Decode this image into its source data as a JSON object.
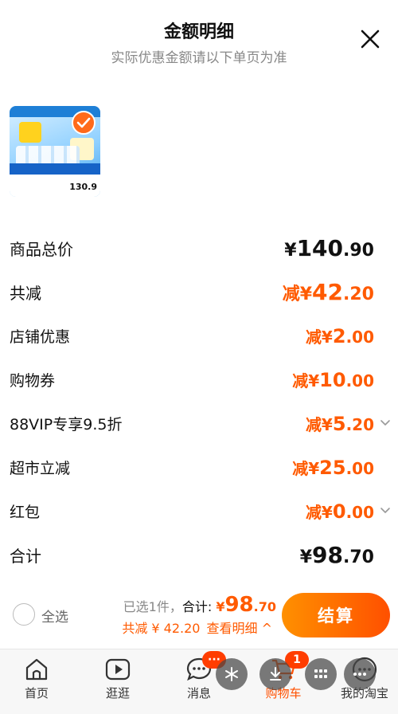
{
  "header": {
    "title": "金额明细",
    "subtitle": "实际优惠金额请以下单页为准"
  },
  "product": {
    "thumbnail_price": "130.9",
    "selected": true
  },
  "rows": {
    "total_price": {
      "label": "商品总价",
      "currency": "¥",
      "int": "140",
      "dec": ".90"
    },
    "total_discount": {
      "label": "共减",
      "prefix": "减¥",
      "int": "42",
      "dec": ".20"
    },
    "shop_discount": {
      "label": "店铺优惠",
      "prefix": "减¥",
      "int": "2",
      "dec": ".00"
    },
    "coupon": {
      "label": "购物券",
      "prefix": "减¥",
      "int": "10",
      "dec": ".00"
    },
    "vip": {
      "label": "88VIP专享9.5折",
      "prefix": "减¥",
      "int": "5",
      "dec": ".20"
    },
    "market": {
      "label": "超市立减",
      "prefix": "减¥",
      "int": "25",
      "dec": ".00"
    },
    "red_packet": {
      "label": "红包",
      "prefix": "减¥",
      "int": "0",
      "dec": ".00"
    },
    "subtotal": {
      "label": "合计",
      "currency": "¥",
      "int": "98",
      "dec": ".70"
    }
  },
  "footer": {
    "select_all": "全选",
    "selected_count": "已选1件，",
    "total_label": "合计: ",
    "total_currency": "¥",
    "total_int": "98",
    "total_dec": ".70",
    "discount_text": "共减 ¥ 42.20",
    "detail_link": "查看明细 ^",
    "checkout": "结算"
  },
  "tabs": [
    {
      "label": "首页",
      "icon": "home-icon"
    },
    {
      "label": "逛逛",
      "icon": "play-icon"
    },
    {
      "label": "消息",
      "icon": "chat-icon",
      "badge": "···"
    },
    {
      "label": "购物车",
      "icon": "cart-icon",
      "badge": "1",
      "active": true
    },
    {
      "label": "我的淘宝",
      "icon": "profile-icon"
    }
  ],
  "colors": {
    "accent": "#ff5a00",
    "checkout_start": "#ff9000",
    "checkout_end": "#ff5000",
    "badge": "#ff3d00"
  }
}
